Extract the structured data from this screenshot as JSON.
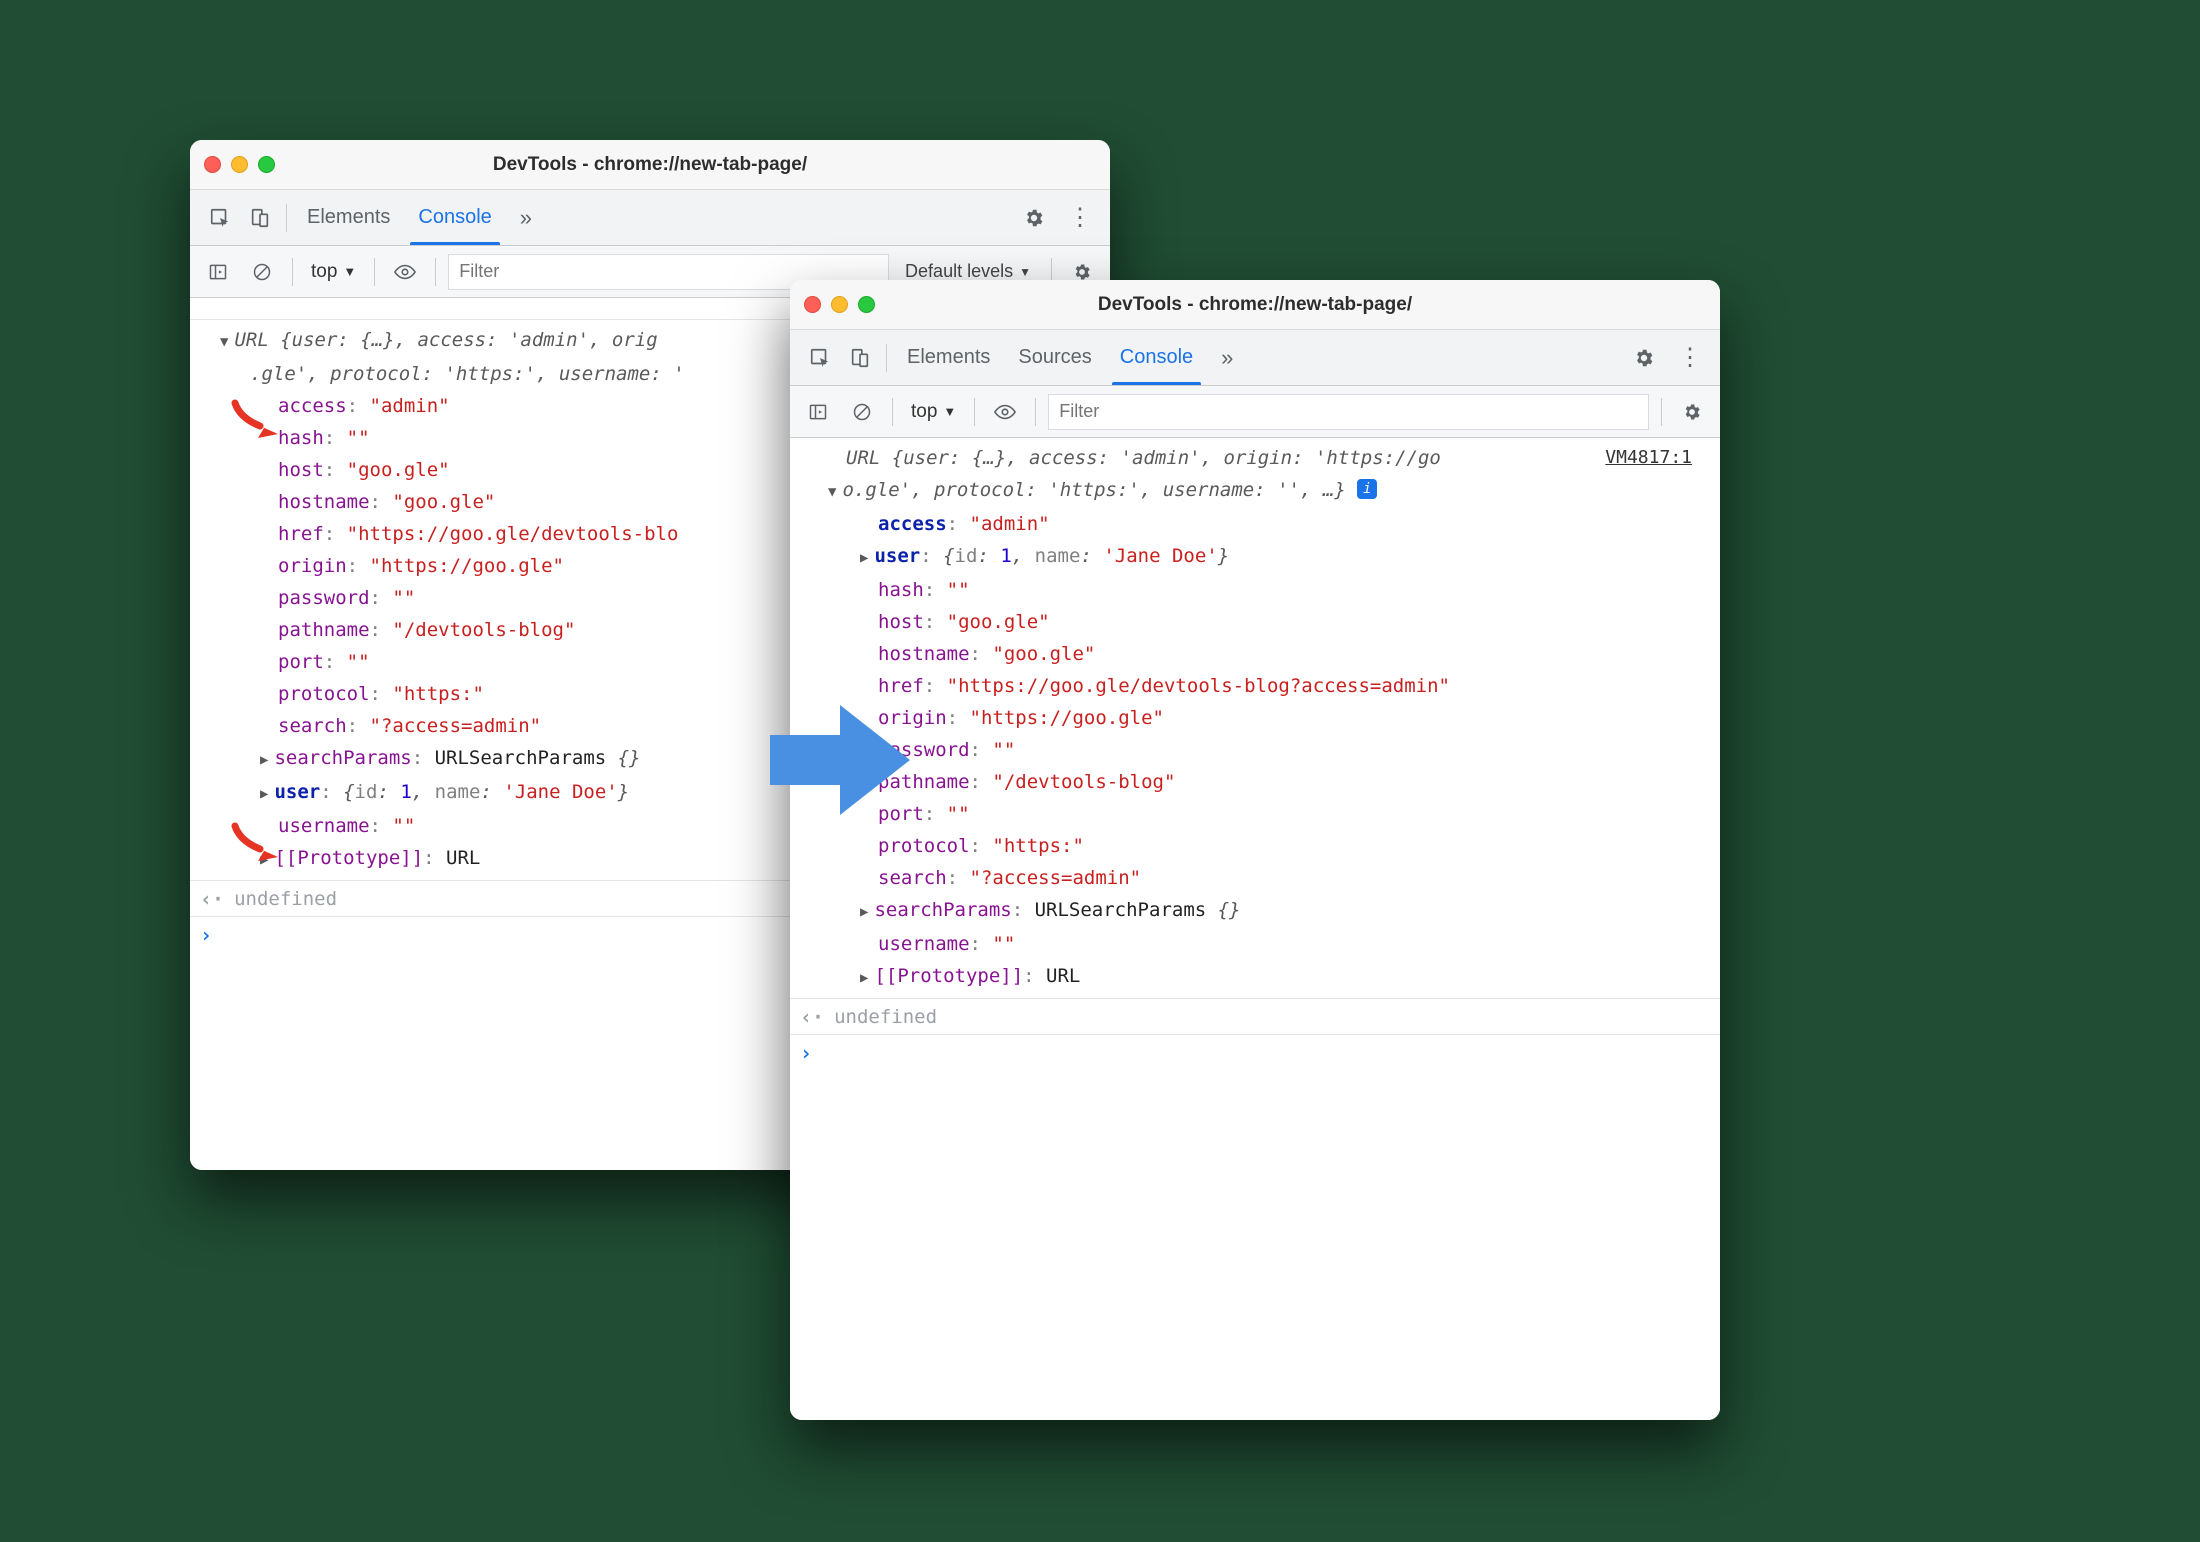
{
  "left": {
    "title": "DevTools - chrome://new-tab-page/",
    "tabs": {
      "elements": "Elements",
      "console": "Console"
    },
    "toolbar": {
      "context": "top",
      "filter_ph": "Filter",
      "levels": "Default levels"
    },
    "header_l1": "URL {user: {…}, access: 'admin', orig",
    "header_l2": ".gle', protocol: 'https:', username: '",
    "props": [
      {
        "k": "access",
        "v": "\"admin\"",
        "vt": "red"
      },
      {
        "k": "hash",
        "v": "\"\"",
        "vt": "red"
      },
      {
        "k": "host",
        "v": "\"goo.gle\"",
        "vt": "red"
      },
      {
        "k": "hostname",
        "v": "\"goo.gle\"",
        "vt": "red"
      },
      {
        "k": "href",
        "v": "\"https://goo.gle/devtools-blo",
        "vt": "red"
      },
      {
        "k": "origin",
        "v": "\"https://goo.gle\"",
        "vt": "red"
      },
      {
        "k": "password",
        "v": "\"\"",
        "vt": "red"
      },
      {
        "k": "pathname",
        "v": "\"/devtools-blog\"",
        "vt": "red"
      },
      {
        "k": "port",
        "v": "\"\"",
        "vt": "red"
      },
      {
        "k": "protocol",
        "v": "\"https:\"",
        "vt": "red"
      },
      {
        "k": "search",
        "v": "\"?access=admin\"",
        "vt": "red"
      }
    ],
    "searchParams_k": "searchParams",
    "searchParams_v": "URLSearchParams {}",
    "user_k": "user",
    "user_id_k": "id",
    "user_id_v": "1",
    "user_name_k": "name",
    "user_name_v": "'Jane Doe'",
    "username_k": "username",
    "username_v": "\"\"",
    "proto_k": "[[Prototype]]",
    "proto_v": "URL",
    "undef": "undefined"
  },
  "right": {
    "title": "DevTools - chrome://new-tab-page/",
    "tabs": {
      "elements": "Elements",
      "sources": "Sources",
      "console": "Console"
    },
    "toolbar": {
      "context": "top",
      "filter_ph": "Filter"
    },
    "vm": "VM4817:1",
    "header_l1": "URL {user: {…}, access: 'admin', origin: 'https://go",
    "header_l2": "o.gle', protocol: 'https:', username: '', …}",
    "access_k": "access",
    "access_v": "\"admin\"",
    "user_k": "user",
    "user_obj": "{id: 1, name: 'Jane Doe'}",
    "user_id_v": "1",
    "user_name_v": "'Jane Doe'",
    "props": [
      {
        "k": "hash",
        "v": "\"\""
      },
      {
        "k": "host",
        "v": "\"goo.gle\""
      },
      {
        "k": "hostname",
        "v": "\"goo.gle\""
      },
      {
        "k": "href",
        "v": "\"https://goo.gle/devtools-blog?access=admin\""
      },
      {
        "k": "origin",
        "v": "\"https://goo.gle\""
      },
      {
        "k": "password",
        "v": "\"\""
      },
      {
        "k": "pathname",
        "v": "\"/devtools-blog\""
      },
      {
        "k": "port",
        "v": "\"\""
      },
      {
        "k": "protocol",
        "v": "\"https:\""
      },
      {
        "k": "search",
        "v": "\"?access=admin\""
      }
    ],
    "searchParams_k": "searchParams",
    "searchParams_v": "URLSearchParams {}",
    "username_k": "username",
    "username_v": "\"\"",
    "proto_k": "[[Prototype]]",
    "proto_v": "URL",
    "undef": "undefined"
  }
}
